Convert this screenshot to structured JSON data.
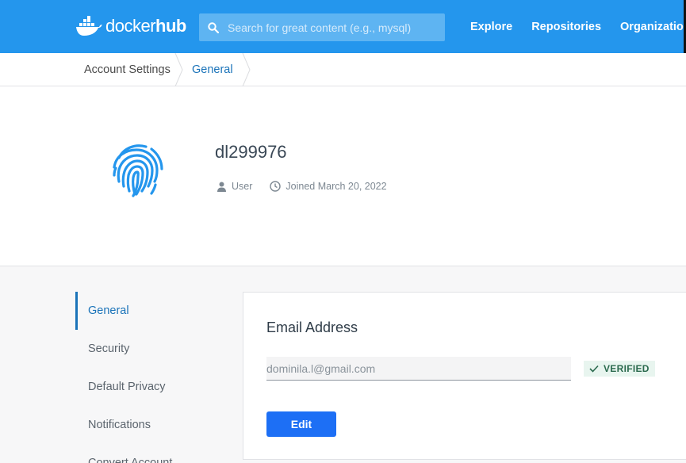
{
  "header": {
    "logo_text_docker": "docker",
    "logo_text_hub": "hub",
    "search_placeholder": "Search for great content (e.g., mysql)",
    "nav": [
      "Explore",
      "Repositories",
      "Organizations"
    ]
  },
  "breadcrumb": {
    "items": [
      "Account Settings",
      "General"
    ]
  },
  "profile": {
    "username": "dl299976",
    "role": "User",
    "joined": "Joined March 20, 2022"
  },
  "sidebar": {
    "items": [
      "General",
      "Security",
      "Default Privacy",
      "Notifications",
      "Convert Account"
    ],
    "active": "General"
  },
  "email_card": {
    "title": "Email Address",
    "email_value": "dominila.l@gmail.com",
    "status": "VERIFIED",
    "edit_label": "Edit"
  },
  "colors": {
    "brand": "#2496ed",
    "link": "#1a73b9",
    "button": "#1d6ff5",
    "verified_bg": "#e8f5ef"
  }
}
